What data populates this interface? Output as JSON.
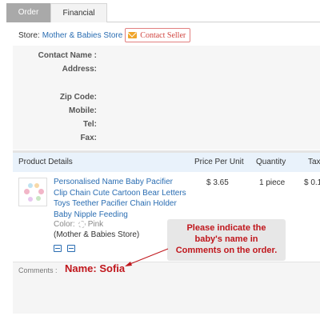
{
  "tabs": [
    {
      "label": "Order",
      "active": true
    },
    {
      "label": "Financial",
      "active": false
    }
  ],
  "store": {
    "prefix": "Store:",
    "name": "Mother & Babies Store",
    "contact_label": "Contact Seller"
  },
  "address": {
    "labels": [
      "Contact Name :",
      "Address:",
      "Zip Code:",
      "Mobile:",
      "Tel:",
      "Fax:"
    ]
  },
  "table": {
    "headers": [
      "Product Details",
      "Price Per Unit",
      "Quantity",
      "Tax"
    ]
  },
  "product": {
    "title": "Personalised Name Baby Pacifier Clip Chain Cute Cartoon Bear Letters Toys Teether Pacifier Chain Holder Baby Nipple Feeding",
    "color_label": "Color:",
    "color_value": "Pink",
    "store": "(Mother & Babies Store)",
    "price": "$ 3.65",
    "quantity": "1 piece",
    "tax": "$ 0.1"
  },
  "comments": {
    "label": "Comments :",
    "value": "Name: Sofia"
  },
  "callout": {
    "text": "Please indicate the baby's name in Comments on the order."
  },
  "icons": [
    "mail-icon",
    "snapshot-icon",
    "detail-icon"
  ],
  "colors": {
    "active_tab": "#a9a9a9",
    "link": "#2a6db2",
    "accent_red": "#c0161c",
    "table_header": "#e9f2fb"
  }
}
